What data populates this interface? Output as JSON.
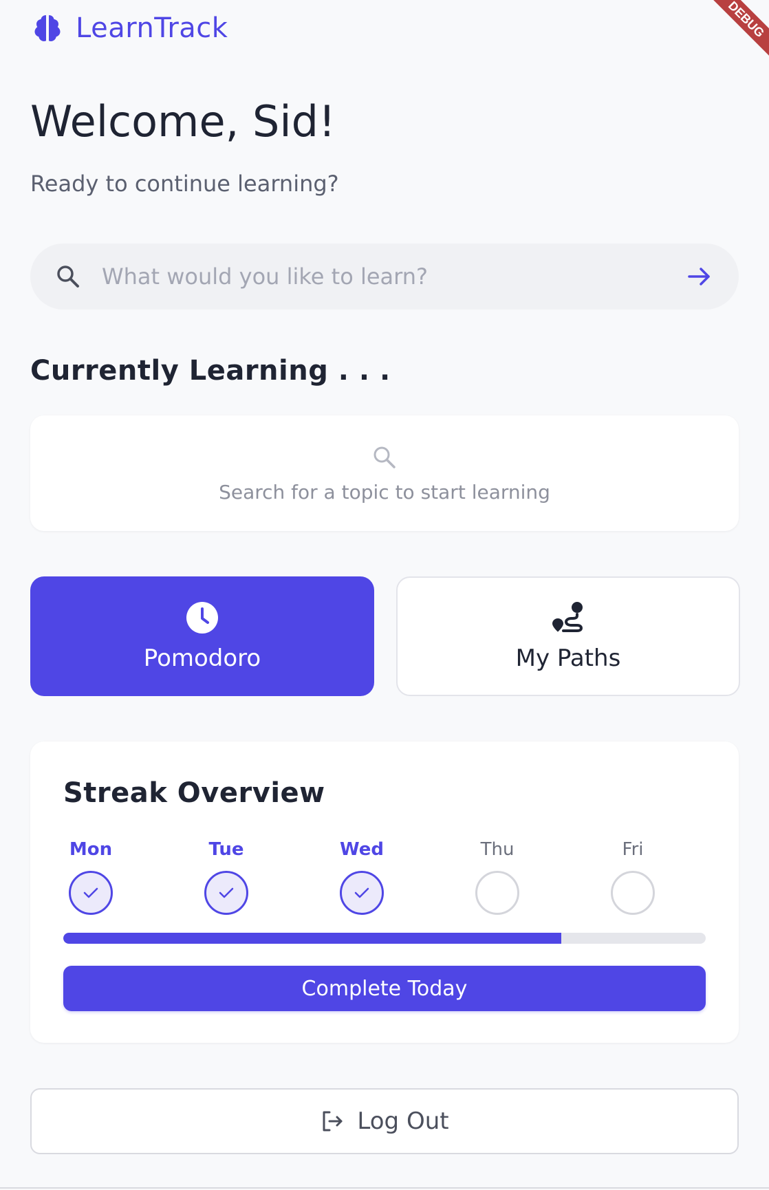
{
  "header": {
    "brand_name": "LearnTrack",
    "brand_icon": "brain-icon",
    "debug_ribbon": "DEBUG"
  },
  "welcome": {
    "title": "Welcome, Sid!",
    "subtitle": "Ready to continue learning?"
  },
  "search": {
    "placeholder": "What would you like to learn?",
    "value": "",
    "icon": "search-icon",
    "submit_icon": "arrow-right-icon"
  },
  "currently_learning": {
    "title": "Currently Learning . . .",
    "empty_icon": "search-icon",
    "empty_text": "Search for a topic to start learning"
  },
  "actions": {
    "pomodoro": {
      "label": "Pomodoro",
      "icon": "clock-icon"
    },
    "paths": {
      "label": "My Paths",
      "icon": "route-icon"
    }
  },
  "streak": {
    "title": "Streak Overview",
    "days": [
      {
        "label": "Mon",
        "completed": true
      },
      {
        "label": "Tue",
        "completed": true
      },
      {
        "label": "Wed",
        "completed": true
      },
      {
        "label": "Thu",
        "completed": false
      },
      {
        "label": "Fri",
        "completed": false
      }
    ],
    "progress_fraction": 0.775,
    "complete_button": "Complete Today"
  },
  "logout": {
    "label": "Log Out",
    "icon": "logout-icon"
  },
  "colors": {
    "accent": "#4f46e5",
    "background": "#f8f9fb",
    "card": "#ffffff",
    "muted_text": "#5b6070"
  }
}
